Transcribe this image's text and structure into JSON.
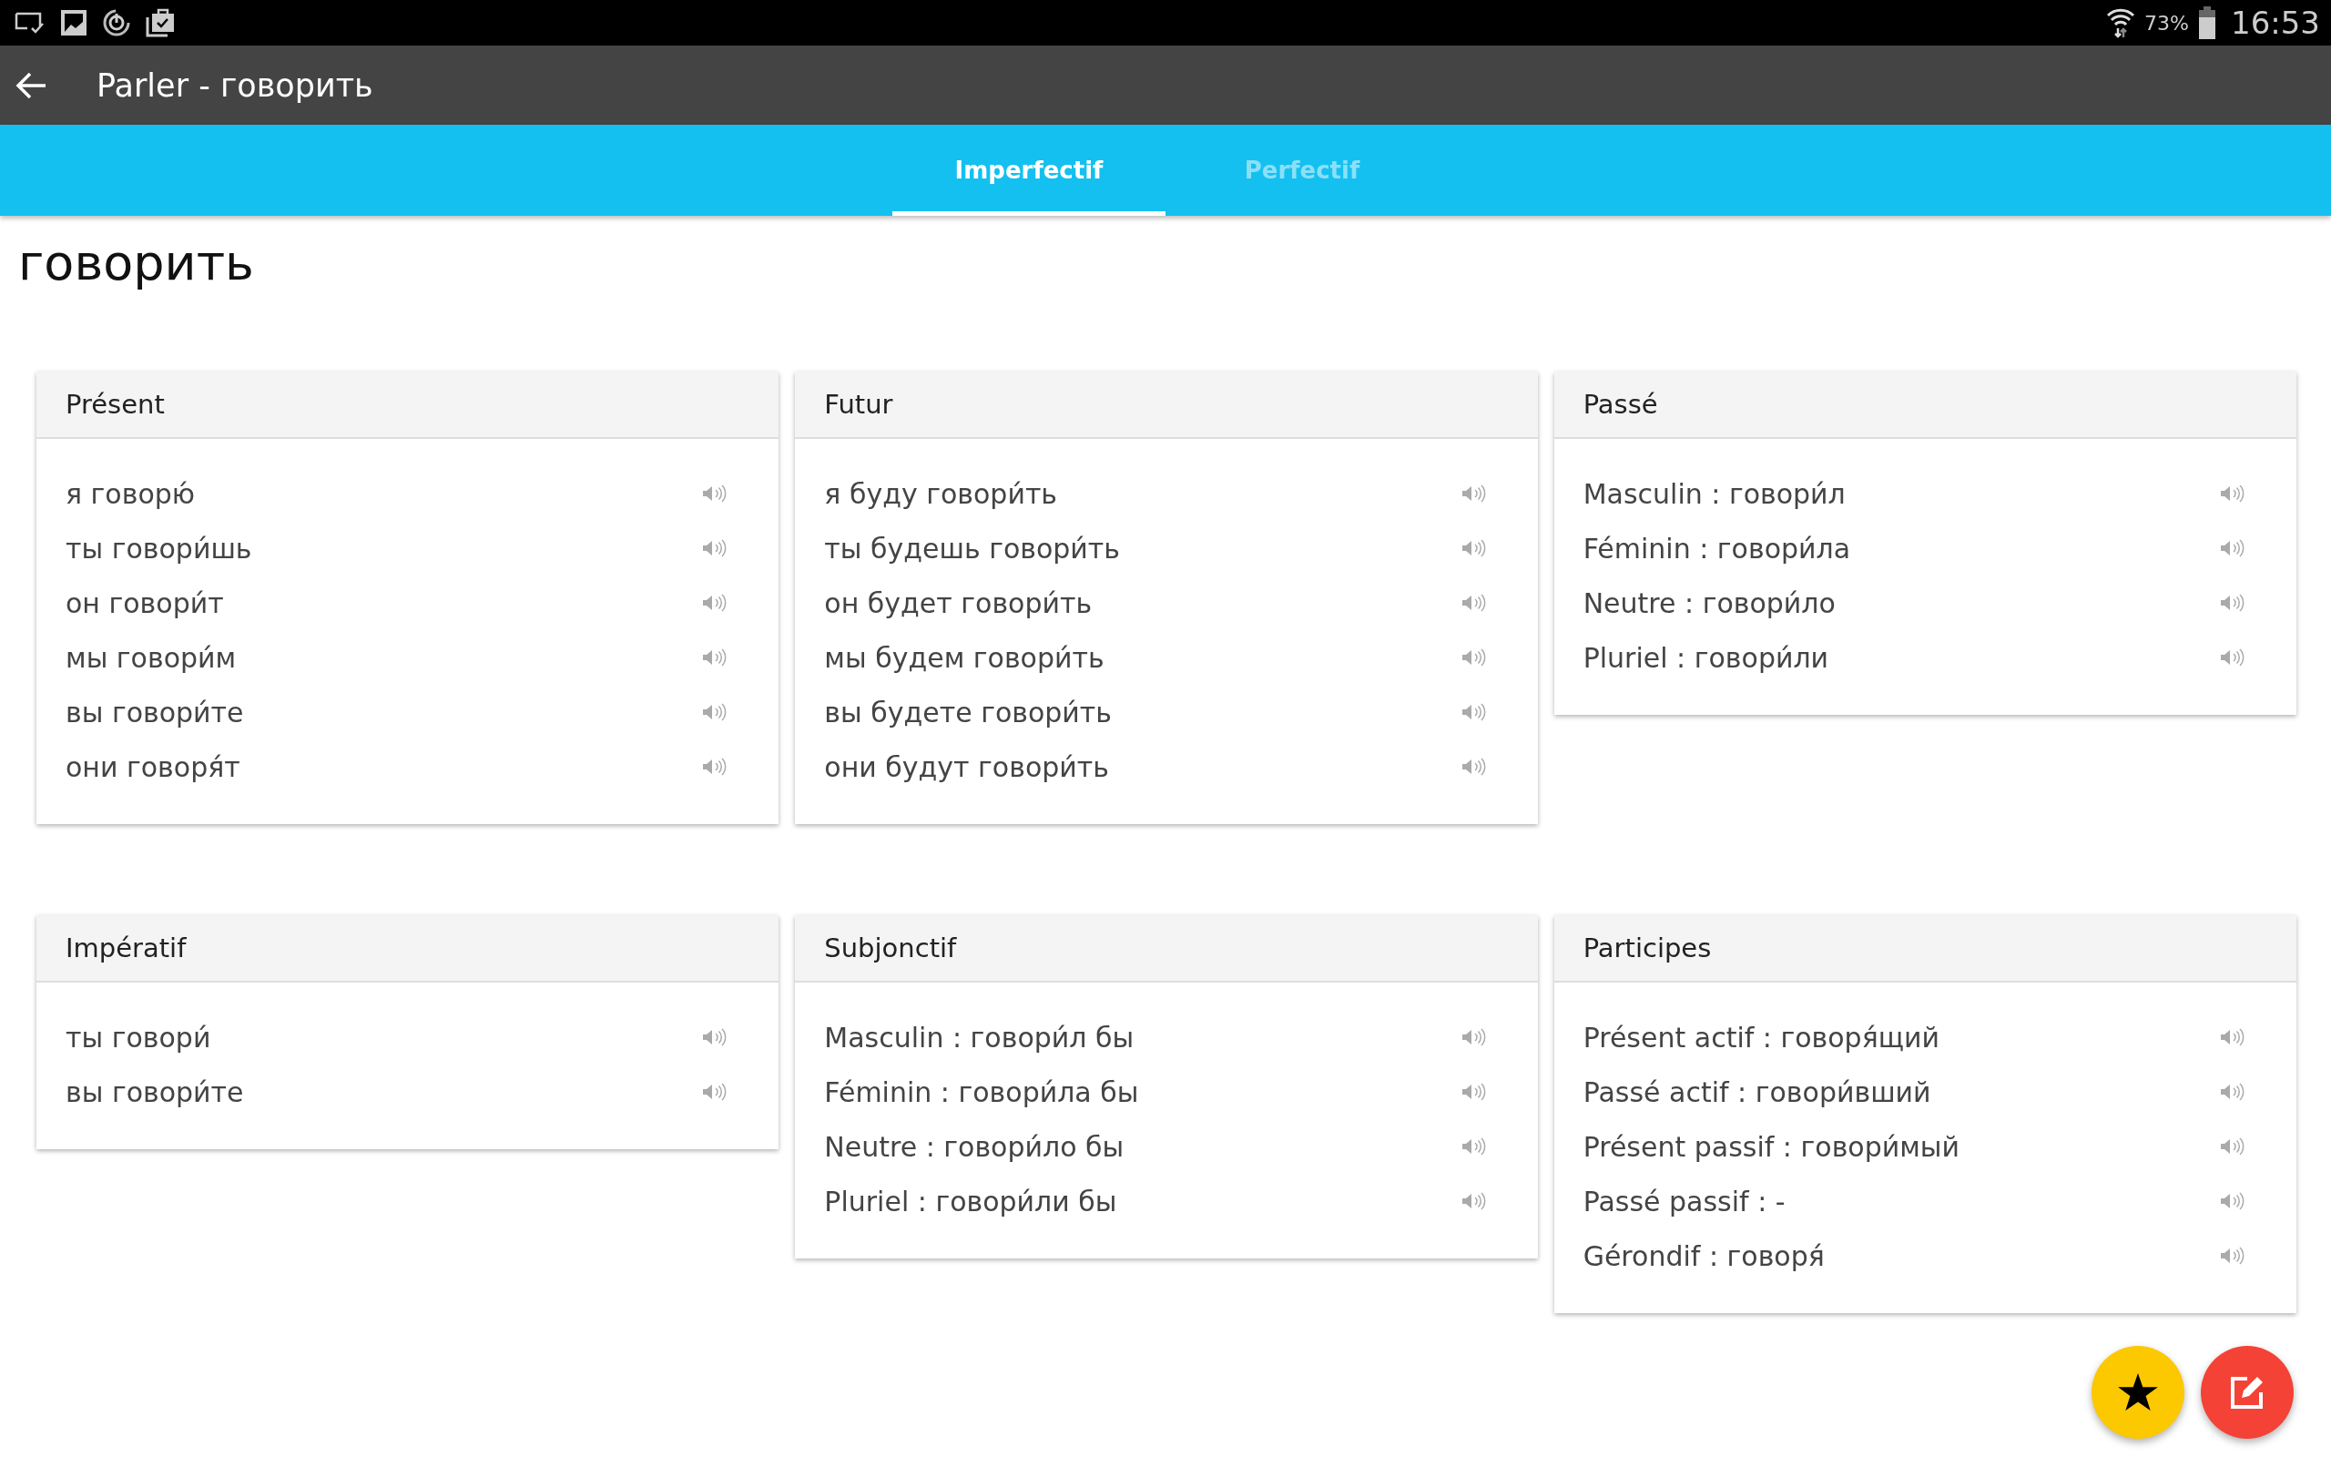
{
  "status_bar": {
    "battery": "73%",
    "time": "16:53"
  },
  "toolbar": {
    "title": "Parler - говорить"
  },
  "tabs": [
    {
      "label": "Imperfectif",
      "selected": true
    },
    {
      "label": "Perfectif",
      "selected": false
    }
  ],
  "heading": "говорить",
  "cards": [
    {
      "title": "Présent",
      "rows": [
        "я говорю́",
        "ты говори́шь",
        "он говори́т",
        "мы говори́м",
        "вы говори́те",
        "они говоря́т"
      ]
    },
    {
      "title": "Futur",
      "rows": [
        "я буду говори́ть",
        "ты будешь говори́ть",
        "он будет говори́ть",
        "мы будем говори́ть",
        "вы будете говори́ть",
        "они будут говори́ть"
      ]
    },
    {
      "title": "Passé",
      "rows": [
        "Masculin : говори́л",
        "Féminin : говори́ла",
        "Neutre : говори́ло",
        "Pluriel : говори́ли"
      ]
    },
    {
      "title": "Impératif",
      "rows": [
        "ты говори́",
        "вы говори́те"
      ]
    },
    {
      "title": "Subjonctif",
      "rows": [
        "Masculin : говори́л бы",
        "Féminin : говори́ла бы",
        "Neutre : говори́ло бы",
        "Pluriel : говори́ли бы"
      ]
    },
    {
      "title": "Participes",
      "rows": [
        "Présent actif : говоря́щий",
        "Passé actif : говори́вший",
        "Présent passif : говори́мый",
        "Passé passif : -",
        "Gérondif : говоря́"
      ]
    }
  ]
}
